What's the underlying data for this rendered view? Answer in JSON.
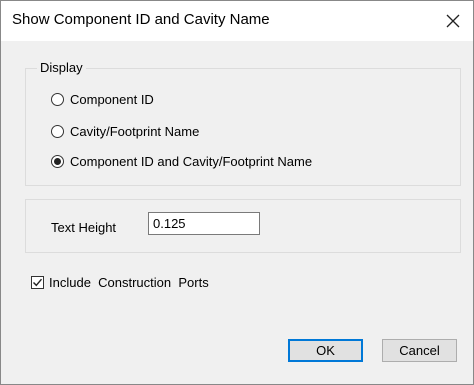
{
  "dialog": {
    "title": "Show Component ID and Cavity Name"
  },
  "display_group": {
    "legend": "Display",
    "options": [
      {
        "label": "Component ID",
        "selected": false
      },
      {
        "label": "Cavity/Footprint Name",
        "selected": false
      },
      {
        "label": "Component ID and Cavity/Footprint Name",
        "selected": true
      }
    ]
  },
  "text_height": {
    "label": "Text Height",
    "value": "0.125"
  },
  "construction_ports": {
    "label": "Include  Construction  Ports",
    "checked": true
  },
  "buttons": {
    "ok": "OK",
    "cancel": "Cancel"
  }
}
